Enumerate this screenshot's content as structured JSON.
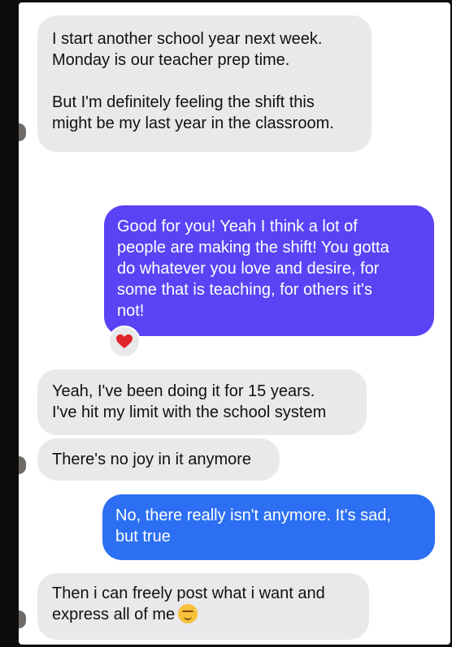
{
  "messages": [
    {
      "direction": "incoming",
      "text": "I start another school year next week.\nMonday is our teacher prep time.\n\nBut I'm definitely feeling the shift this\nmight be my last year in the classroom."
    },
    {
      "direction": "outgoing",
      "text": "Good for you! Yeah I think a lot of\npeople are making the shift! You gotta\ndo whatever you love and desire, for\nsome that is teaching, for others it's\nnot!",
      "reaction": "heart-icon"
    },
    {
      "direction": "incoming",
      "text": "Yeah, I've been doing it for 15 years.\nI've hit my limit with the school system"
    },
    {
      "direction": "incoming",
      "text": "There's no joy in it anymore"
    },
    {
      "direction": "outgoing",
      "text": "No, there really isn't anymore. It's sad,\nbut true"
    },
    {
      "direction": "incoming",
      "text": "Then i can freely post what i want and\nexpress all of me",
      "emoji": "smirk-emoji-icon"
    }
  ],
  "colors": {
    "incoming_bubble": "#e9e9eb",
    "outgoing_bubble_purple": "#5a43f5",
    "outgoing_bubble_blue": "#2c6ff3",
    "heart": "#e0242b"
  }
}
